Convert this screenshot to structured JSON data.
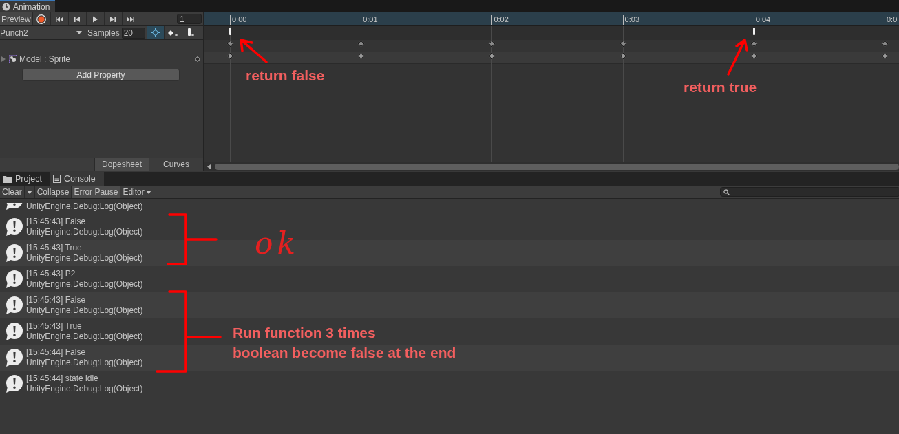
{
  "window": {
    "tab": "Animation"
  },
  "toolbar": {
    "preview": "Preview",
    "recording": false,
    "frame": "1"
  },
  "clip": {
    "name": "Punch2",
    "samples_label": "Samples",
    "samples": "20",
    "keyframe_mode_on": true
  },
  "properties": [
    {
      "label": "Model : Sprite",
      "expanded": false
    }
  ],
  "add_property": "Add Property",
  "view_tabs": [
    {
      "label": "Dopesheet",
      "selected": true
    },
    {
      "label": "Curves",
      "selected": false
    }
  ],
  "timeline": {
    "ticks": [
      {
        "label": "0:00",
        "event": true,
        "playhead": false,
        "keyframe": true
      },
      {
        "label": "0:01",
        "event": false,
        "playhead": true,
        "keyframe": true
      },
      {
        "label": "0:02",
        "event": false,
        "playhead": false,
        "keyframe": true
      },
      {
        "label": "0:03",
        "event": false,
        "playhead": false,
        "keyframe": true
      },
      {
        "label": "0:04",
        "event": true,
        "playhead": false,
        "keyframe": true
      },
      {
        "label": "0:0",
        "event": false,
        "playhead": false,
        "keyframe": true
      }
    ]
  },
  "panel_tabs": [
    {
      "label": "Project",
      "selected": false
    },
    {
      "label": "Console",
      "selected": true
    }
  ],
  "console_toolbar": [
    {
      "kind": "button",
      "label": "Clear",
      "on": false
    },
    {
      "kind": "dropdown",
      "on": false
    },
    {
      "kind": "button",
      "label": "Collapse",
      "on": false
    },
    {
      "kind": "button",
      "label": "Error Pause",
      "on": true
    },
    {
      "kind": "menu",
      "label": "Editor",
      "on": false
    }
  ],
  "log": [
    {
      "line2": "UnityEngine.Debug:Log(Object)"
    },
    {
      "line1": "[15:45:43] False",
      "line2": "UnityEngine.Debug:Log(Object)"
    },
    {
      "line1": "[15:45:43] True",
      "line2": "UnityEngine.Debug:Log(Object)"
    },
    {
      "line1": "[15:45:43] P2",
      "line2": "UnityEngine.Debug:Log(Object)"
    },
    {
      "line1": "[15:45:43] False",
      "line2": "UnityEngine.Debug:Log(Object)"
    },
    {
      "line1": "[15:45:43] True",
      "line2": "UnityEngine.Debug:Log(Object)"
    },
    {
      "line1": "[15:45:44] False",
      "line2": "UnityEngine.Debug:Log(Object)"
    },
    {
      "line1": "[15:45:44] state idle",
      "line2": "UnityEngine.Debug:Log(Object)"
    }
  ],
  "annotations": [
    {
      "kind": "label",
      "text": "return false"
    },
    {
      "kind": "label",
      "text": "return true"
    },
    {
      "kind": "handwriting",
      "text": "ok"
    },
    {
      "kind": "label",
      "text": "Run function 3 times"
    },
    {
      "kind": "label",
      "text": "boolean become false at the end"
    }
  ]
}
